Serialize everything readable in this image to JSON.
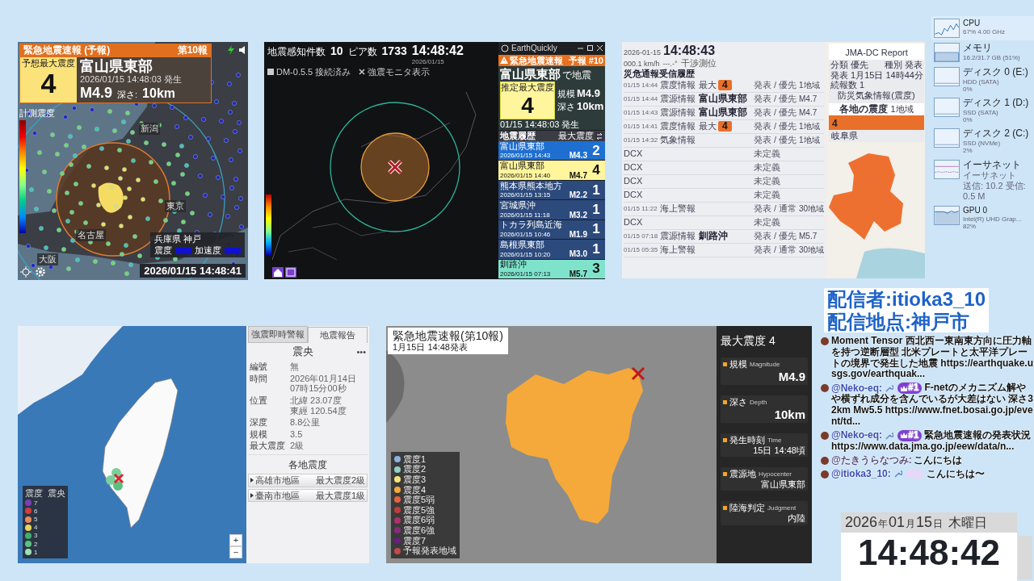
{
  "quake_map": {
    "title": "緊急地震速報 (予報)",
    "report": "第10報",
    "intensity_label": "予想最大震度",
    "intensity": "4",
    "region": "富山県東部",
    "origin_time": "2026/01/15 14:48:03 発生",
    "magnitude": "M4.9",
    "depth_label": "深さ:",
    "depth": "10km",
    "scale_label": "計測震度",
    "places": [
      "新潟",
      "東京",
      "名古屋",
      "大阪"
    ],
    "station": {
      "name": "兵庫県 神戸",
      "intensity_label": "震度",
      "acceleration_label": "加速度"
    },
    "timestamp": "2026/01/15 14:48:41"
  },
  "monitor": {
    "stats": [
      {
        "label": "地震感知件数",
        "value": "10"
      },
      {
        "label": "ピア数",
        "value": "1733"
      }
    ],
    "clock": "14:48:42",
    "date": "2026/01/15",
    "status": {
      "label": "DM-0.5.5 接続済み",
      "checked": true
    },
    "toggle": "強震モニタ表示",
    "app_name": "EarthQuickly",
    "eew": {
      "title": "緊急地震速報",
      "report": "予報 #10",
      "region": "富山県東部",
      "suffix": "で地震",
      "intensity_label": "推定最大震度",
      "intensity": "4",
      "magnitude_label": "規模",
      "magnitude": "M4.9",
      "depth_label": "深さ",
      "depth": "10km",
      "time": "01/15 14:48:03 発生"
    },
    "history_title": "地震履歴",
    "history_max_label": "最大震度",
    "history": [
      {
        "region": "富山県東部",
        "time": "2026/01/15 14:43",
        "magnitude": "M4.3",
        "intensity": "2",
        "color": "#1e6fd0"
      },
      {
        "region": "富山県東部",
        "time": "2026/01/15 14:40",
        "magnitude": "M4.7",
        "intensity": "4",
        "color": "#fff59d"
      },
      {
        "region": "熊本県熊本地方",
        "time": "2026/01/15 13:15",
        "magnitude": "M2.2",
        "intensity": "1",
        "color": "#2c4a7c"
      },
      {
        "region": "宮城県沖",
        "time": "2026/01/15 11:18",
        "magnitude": "M3.2",
        "intensity": "1",
        "color": "#2c4a7c"
      },
      {
        "region": "トカラ列島近海",
        "time": "2026/01/15 10:46",
        "magnitude": "M1.9",
        "intensity": "1",
        "color": "#2c4a7c"
      },
      {
        "region": "島根県東部",
        "time": "2026/01/15 10:20",
        "magnitude": "M3.0",
        "intensity": "1",
        "color": "#2c4a7c"
      },
      {
        "region": "釧路沖",
        "time": "2026/01/15 07:13",
        "magnitude": "M5.7",
        "intensity": "3",
        "color": "#7fe3cc"
      }
    ]
  },
  "jma_receiver": {
    "date": "2026-01-15",
    "time": "14:48:43",
    "speed": "000.1 km/h",
    "heading": "---.-°",
    "mode": "干渉測位",
    "list_title": "災危通報受信履歴",
    "entries": [
      {
        "kind": "intensity",
        "time": "01/15 14:44",
        "type": "震度情報",
        "label": "最大",
        "value": "4",
        "status": "発表 / 優先",
        "sub": "1地域"
      },
      {
        "kind": "region",
        "time": "01/15 14:44",
        "type": "震源情報",
        "value": "富山県東部",
        "status": "発表 / 優先",
        "sub": "M4.7"
      },
      {
        "kind": "region",
        "time": "01/15 14:43",
        "type": "震源情報",
        "value": "富山県東部",
        "status": "発表 / 優先",
        "sub": "M4.7"
      },
      {
        "kind": "intensity",
        "time": "01/15 14:41",
        "type": "震度情報",
        "label": "最大",
        "value": "4",
        "status": "発表 / 優先",
        "sub": "1地域"
      },
      {
        "kind": "region",
        "time": "01/15 14:32",
        "type": "気象情報",
        "status": "発表 / 優先",
        "sub": "1地域"
      },
      {
        "kind": "unknown",
        "value": "DCX",
        "status": "未定義"
      },
      {
        "kind": "unknown",
        "value": "DCX",
        "status": "未定義"
      },
      {
        "kind": "unknown",
        "value": "DCX",
        "status": "未定義"
      },
      {
        "kind": "unknown",
        "value": "DCX",
        "status": "未定義"
      },
      {
        "kind": "region",
        "time": "01/15 11:22",
        "type": "海上警報",
        "status": "発表 / 通常",
        "sub": "30地域"
      },
      {
        "kind": "unknown",
        "value": "DCX",
        "status": "未定義"
      },
      {
        "kind": "region",
        "time": "01/15 07:18",
        "type": "震源情報",
        "value": "釧路沖",
        "status": "発表 / 優先",
        "sub": "M5.7"
      },
      {
        "kind": "region",
        "time": "01/15 05:35",
        "type": "海上警報",
        "status": "発表 / 通常",
        "sub": "30地域"
      }
    ],
    "report": {
      "title": "JMA-DC Report",
      "class": "分類 優先",
      "category": "種別 発表",
      "issued": "発表 1月15日 14時44分",
      "count": "続報数 1",
      "info": "防災気象情報(震度)",
      "section": "各地の震度",
      "areas": "1地域",
      "intensity": "4",
      "prefecture": "岐阜県"
    }
  },
  "task_manager": {
    "items": [
      {
        "kind": "cpu",
        "name": "CPU",
        "lines": [
          "67% 4.00 GHz"
        ],
        "selected": true
      },
      {
        "kind": "memory",
        "name": "メモリ",
        "lines": [
          "16.2/31.7 GB (51%)"
        ],
        "selected": false
      },
      {
        "kind": "disk",
        "name": "ディスク 0 (E:)",
        "lines": [
          "HDD (SATA)",
          "0%"
        ],
        "selected": false
      },
      {
        "kind": "disk",
        "name": "ディスク 1 (D:)",
        "lines": [
          "SSD (SATA)",
          "0%"
        ],
        "selected": false
      },
      {
        "kind": "disk",
        "name": "ディスク 2 (C:)",
        "lines": [
          "SSD (NVMe)",
          "2%"
        ],
        "selected": false
      },
      {
        "kind": "network",
        "name": "イーサネット",
        "lines": [
          "イーサネット",
          "送信: 10.2 受信: 0.5 M"
        ],
        "selected": false
      },
      {
        "kind": "gpu",
        "name": "GPU 0",
        "lines": [
          "Intel(R) UHD Grap...",
          "82%"
        ],
        "selected": false
      }
    ]
  },
  "taiwan_report": {
    "tabs": [
      {
        "label": "強震即時警報",
        "selected": false
      },
      {
        "label": "地震報告",
        "selected": true
      }
    ],
    "heading": "震央",
    "more": "•••",
    "fields": [
      {
        "label": "編號",
        "values": [
          "無"
        ]
      },
      {
        "label": "時間",
        "values": [
          "2026年01月14日",
          "07時15分00秒"
        ]
      },
      {
        "label": "位置",
        "values": [
          "北緯 23.07度",
          "東經 120.54度"
        ]
      },
      {
        "label": "深度",
        "values": [
          "8.8公里"
        ]
      },
      {
        "label": "規模",
        "values": [
          "3.5"
        ]
      },
      {
        "label": "最大震度",
        "values": [
          "2級"
        ]
      }
    ],
    "areas_heading": "各地震度",
    "areas": [
      {
        "name": "高雄市地區",
        "max": "最大震度2級"
      },
      {
        "name": "臺南市地區",
        "max": "最大震度1級"
      }
    ],
    "legend": {
      "intensity_label": "震度",
      "epicenter_label": "震央",
      "levels": [
        {
          "label": "7",
          "color": "#7b3fb5"
        },
        {
          "label": "6",
          "color": "#d23c3c"
        },
        {
          "label": "5",
          "color": "#e88a55"
        },
        {
          "label": "4",
          "color": "#e8d35a"
        },
        {
          "label": "3",
          "color": "#3fae6a"
        },
        {
          "label": "2",
          "color": "#5cc27e"
        },
        {
          "label": "1",
          "color": "#9fe0b0"
        }
      ]
    },
    "zoom_in": "+",
    "zoom_out": "−"
  },
  "eew_summary": {
    "title": "緊急地震速報(第10報)",
    "issued": "1月15日 14:48発表",
    "max_intensity": "最大震度 4",
    "rows": [
      {
        "label": "規模",
        "label_en": "Magnitude",
        "value": "M4.9",
        "kind": "primary"
      },
      {
        "label": "深さ",
        "label_en": "Depth",
        "value": "10km",
        "kind": "primary"
      },
      {
        "label": "発生時刻",
        "label_en": "Time",
        "value": "15日 14:48頃",
        "kind": "secondary"
      },
      {
        "label": "震源地",
        "label_en": "Hypocenter",
        "value": "富山県東部",
        "kind": "secondary"
      },
      {
        "label": "陸海判定",
        "label_en": "Judgment",
        "value": "内陸",
        "kind": "secondary"
      }
    ],
    "legend": [
      {
        "label": "震度1",
        "color": "#8fb3e0"
      },
      {
        "label": "震度2",
        "color": "#8fd1c8"
      },
      {
        "label": "震度3",
        "color": "#f4e47b"
      },
      {
        "label": "震度4",
        "color": "#f5a93a"
      },
      {
        "label": "震度5弱",
        "color": "#e5633b"
      },
      {
        "label": "震度5強",
        "color": "#c33b3b"
      },
      {
        "label": "震度6弱",
        "color": "#b0306a"
      },
      {
        "label": "震度6強",
        "color": "#8a2a7a"
      },
      {
        "label": "震度7",
        "color": "#6a1f7a"
      },
      {
        "label": "予報発表地域",
        "color": "#c24a4a"
      }
    ]
  },
  "stream_overlay": {
    "lines": [
      "配信者:itioka3_10",
      "配信地点:神戸市"
    ]
  },
  "chat": {
    "messages": [
      {
        "kind": "plain",
        "moderator": false,
        "text": "Moment Tensor 西北西ー東南東方向に圧力軸を持つ逆断層型 北米プレートと太平洋プレートの境界で発生した地震 https://earthquake.usgs.gov/earthquak..."
      },
      {
        "kind": "ranked",
        "user": "@Neko-eq:",
        "moderator": true,
        "badge": "#1",
        "text": "F-netのメカニズム解やや横ずれ成分を含んでいるが大差はない 深さ32km Mw5.5 https://www.fnet.bosai.go.jp/event/td..."
      },
      {
        "kind": "ranked",
        "user": "@Neko-eq:",
        "moderator": true,
        "badge": "#1",
        "text": "緊急地震速報の発表状況 https://www.data.jma.go.jp/eew/data/n..."
      },
      {
        "kind": "plain",
        "user": "@たきうらなつみ:",
        "moderator": false,
        "text": "こんにちは"
      },
      {
        "kind": "member",
        "user": "@itioka3_10:",
        "moderator": true,
        "text": "こんにちは〜"
      }
    ]
  },
  "clock": {
    "date_parts": [
      {
        "text": "2026",
        "unit": false
      },
      {
        "text": "年",
        "unit": true
      },
      {
        "text": "01",
        "unit": false
      },
      {
        "text": "月",
        "unit": true
      },
      {
        "text": "15",
        "unit": false
      },
      {
        "text": "日",
        "unit": true
      }
    ],
    "weekday": "木曜日",
    "time": "14:48:42"
  }
}
